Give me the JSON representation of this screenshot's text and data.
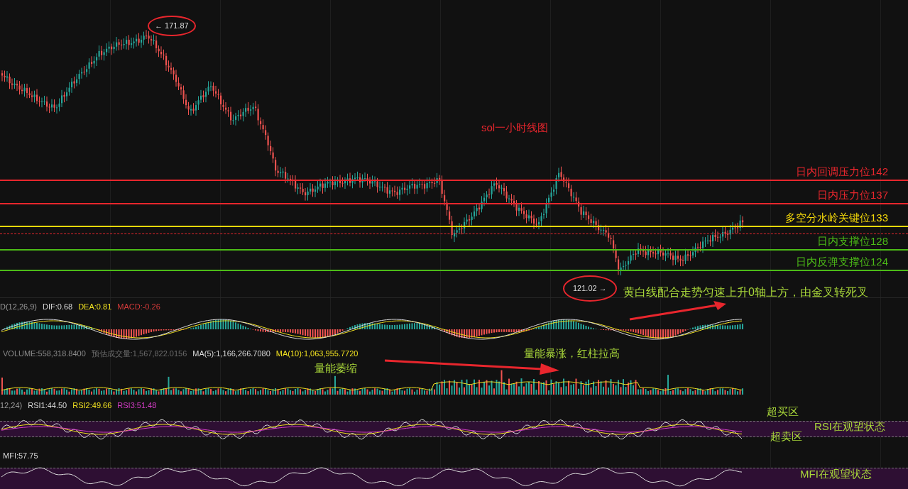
{
  "chart_title": "sol一小时线图",
  "price_markers": [
    {
      "text": "← 171.87"
    },
    {
      "text": "121.02 →"
    }
  ],
  "levels": [
    {
      "label": "日内回调压力位142",
      "color": "#e8262d"
    },
    {
      "label": "日内压力位137",
      "color": "#e8262d"
    },
    {
      "label": "多空分水岭关键位133",
      "color": "#f5d90a"
    },
    {
      "label": "日内支撑位128",
      "color": "#4cbb17"
    },
    {
      "label": "日内反弹支撑位124",
      "color": "#4cbb17"
    }
  ],
  "macd": {
    "readings": [
      {
        "text": "D(12,26,9)",
        "color": "#9a9a9a"
      },
      {
        "text": "DIF:0.68",
        "color": "#d9d9d9"
      },
      {
        "text": "DEA:0.81",
        "color": "#f0e020"
      },
      {
        "text": "MACD:-0.26",
        "color": "#d33a3a"
      }
    ],
    "note": "黄白线配合走势匀速上升0轴上方，由金叉转死叉"
  },
  "volume": {
    "readings": [
      {
        "text": "VOLUME:558,318.8400",
        "color": "#8a8a8a"
      },
      {
        "text": "预估成交量:1,567,822.0156",
        "color": "#6a6a6a"
      },
      {
        "text": "MA(5):1,166,266.7080",
        "color": "#d9d9d9"
      },
      {
        "text": "MA(10):1,063,955.7720",
        "color": "#f0e020"
      }
    ],
    "notes": [
      "量能萎缩",
      "量能暴涨，红柱拉高"
    ]
  },
  "rsi": {
    "readings": [
      {
        "text": "12,24)",
        "color": "#9a9a9a"
      },
      {
        "text": "RSI1:44.50",
        "color": "#d9d9d9"
      },
      {
        "text": "RSI2:49.66",
        "color": "#f0e020"
      },
      {
        "text": "RSI3:51.48",
        "color": "#d63cc8"
      }
    ],
    "overbought": "超买区",
    "oversold": "超卖区",
    "note": "RSI在观望状态"
  },
  "mfi": {
    "readings": [
      {
        "text": "MFI:57.75",
        "color": "#d9d9d9"
      }
    ],
    "note": "MFI在观望状态"
  }
}
